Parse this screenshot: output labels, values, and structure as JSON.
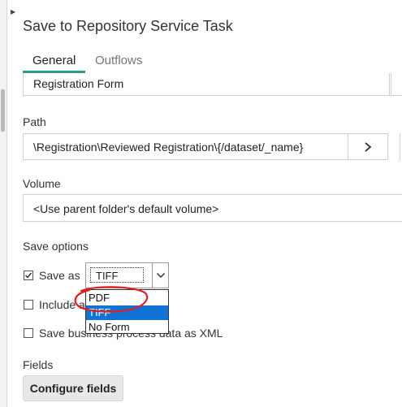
{
  "panel": {
    "title": "Save to Repository Service Task"
  },
  "tabs": [
    {
      "label": "General",
      "active": true
    },
    {
      "label": "Outflows",
      "active": false
    }
  ],
  "form_name": {
    "value": "Registration Form"
  },
  "path": {
    "label": "Path",
    "value": "\\Registration\\Reviewed Registration\\{/dataset/_name}",
    "browse_icon": "chevron-right-icon"
  },
  "volume": {
    "label": "Volume",
    "value": "<Use parent folder's default volume>"
  },
  "save_options": {
    "label": "Save options",
    "save_as": {
      "label": "Save as",
      "checked": true,
      "selected": "TIFF",
      "options": [
        "PDF",
        "TIFF",
        "No Form"
      ],
      "highlighted": "TIFF"
    },
    "include": {
      "label": "Include a",
      "checked": false
    },
    "save_business": {
      "label": "Save business process data as XML",
      "checked": false
    }
  },
  "fields": {
    "label": "Fields",
    "button": "Configure fields"
  },
  "colors": {
    "accent": "#2a9a8a",
    "selection": "#1173d4",
    "annotation": "#e02020"
  }
}
